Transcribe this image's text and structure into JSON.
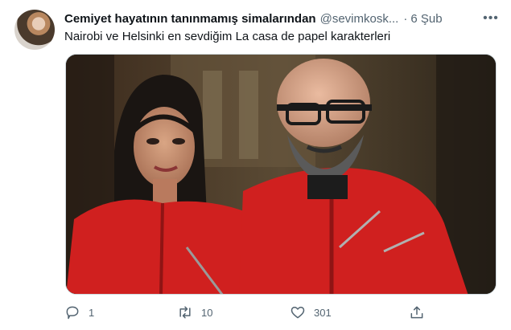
{
  "tweet": {
    "author_name": "Cemiyet hayatının tanınmamış simalarından",
    "handle": "@sevimkosk...",
    "separator": "·",
    "date": "6 Şub",
    "more_icon": "more-horizontal-icon",
    "text": "Nairobi ve Helsinki en sevdiğim La casa de papel karakterleri"
  },
  "actions": {
    "reply": {
      "icon": "reply-icon",
      "count": "1"
    },
    "retweet": {
      "icon": "retweet-icon",
      "count": "10"
    },
    "like": {
      "icon": "heart-icon",
      "count": "301"
    },
    "share": {
      "icon": "share-icon"
    }
  },
  "colors": {
    "text_primary": "#0f1419",
    "text_secondary": "#536471",
    "border": "#cfd9de",
    "jumpsuit_red": "#d0201f"
  }
}
